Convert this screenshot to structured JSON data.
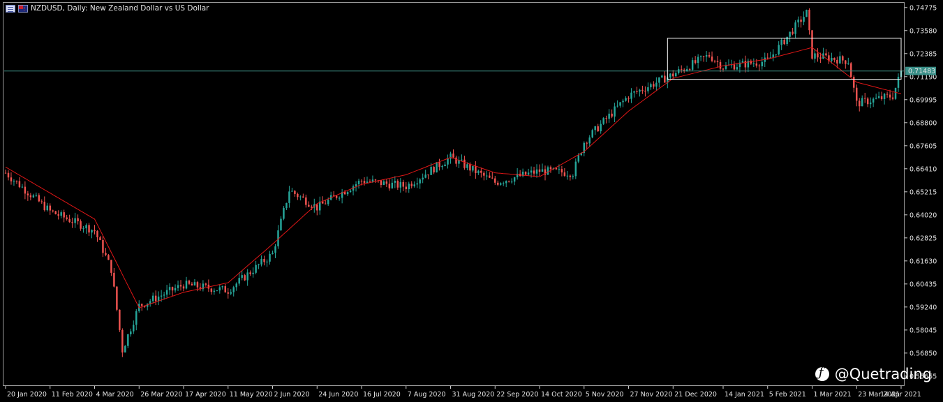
{
  "window": {
    "title": "NZDUSD, Daily:  New Zealand Dollar vs US Dollar",
    "icons": [
      "list-icon",
      "flag-icon"
    ]
  },
  "watermark": {
    "text": "@Quetrading",
    "icon": "logo-icon"
  },
  "colors": {
    "background": "#000000",
    "bull": "#26a69a",
    "bear": "#ef5350",
    "ma": "#e01616",
    "price_line": "#3e8f86",
    "price_tag": "#3a8f88",
    "box": "#ffffff",
    "grid_text": "#e6e6e6"
  },
  "chart_data": {
    "type": "candlestick",
    "symbol": "NZDUSD",
    "timeframe": "Daily",
    "title": "NZDUSD, Daily:  New Zealand Dollar vs US Dollar",
    "y_axis": {
      "ylim": [
        0.5518,
        0.7502
      ],
      "ticks": [
        "0.74775",
        "0.73580",
        "0.72385",
        "0.71190",
        "0.69995",
        "0.68800",
        "0.67605",
        "0.66410",
        "0.65215",
        "0.64020",
        "0.62825",
        "0.61630",
        "0.60435",
        "0.59240",
        "0.58045",
        "0.56850",
        "0.55655"
      ]
    },
    "x_axis": {
      "ticks": [
        "20 Jan 2020",
        "11 Feb 2020",
        "4 Mar 2020",
        "26 Mar 2020",
        "17 Apr 2020",
        "11 May 2020",
        "2 Jun 2020",
        "24 Jun 2020",
        "16 Jul 2020",
        "7 Aug 2020",
        "31 Aug 2020",
        "22 Sep 2020",
        "14 Oct 2020",
        "5 Nov 2020",
        "27 Nov 2020",
        "21 Dec 2020",
        "14 Jan 2021",
        "5 Feb 2021",
        "1 Mar 2021",
        "23 Mar 2021",
        "14 Apr 2021"
      ]
    },
    "current_price": "0.71483",
    "grid": false,
    "legend": "none",
    "price_path": [
      {
        "date": "20 Jan 2020",
        "price": 0.662
      },
      {
        "date": "11 Feb 2020",
        "price": 0.642
      },
      {
        "date": "4 Mar 2020",
        "price": 0.632
      },
      {
        "date": "12 Mar 2020",
        "price": 0.612
      },
      {
        "date": "18 Mar 2020",
        "price": 0.57
      },
      {
        "date": "26 Mar 2020",
        "price": 0.593
      },
      {
        "date": "17 Apr 2020",
        "price": 0.604
      },
      {
        "date": "11 May 2020",
        "price": 0.601
      },
      {
        "date": "2 Jun 2020",
        "price": 0.62
      },
      {
        "date": "10 Jun 2020",
        "price": 0.653
      },
      {
        "date": "24 Jun 2020",
        "price": 0.644
      },
      {
        "date": "16 Jul 2020",
        "price": 0.658
      },
      {
        "date": "7 Aug 2020",
        "price": 0.655
      },
      {
        "date": "31 Aug 2020",
        "price": 0.67
      },
      {
        "date": "22 Sep 2020",
        "price": 0.657
      },
      {
        "date": "14 Oct 2020",
        "price": 0.663
      },
      {
        "date": "30 Oct 2020",
        "price": 0.662
      },
      {
        "date": "5 Nov 2020",
        "price": 0.678
      },
      {
        "date": "27 Nov 2020",
        "price": 0.702
      },
      {
        "date": "21 Dec 2020",
        "price": 0.713
      },
      {
        "date": "7 Jan 2021",
        "price": 0.723
      },
      {
        "date": "14 Jan 2021",
        "price": 0.717
      },
      {
        "date": "5 Feb 2021",
        "price": 0.72
      },
      {
        "date": "25 Feb 2021",
        "price": 0.745
      },
      {
        "date": "1 Mar 2021",
        "price": 0.723
      },
      {
        "date": "18 Mar 2021",
        "price": 0.72
      },
      {
        "date": "23 Mar 2021",
        "price": 0.698
      },
      {
        "date": "9 Apr 2021",
        "price": 0.702
      },
      {
        "date": "14 Apr 2021",
        "price": 0.7145
      }
    ],
    "moving_average": [
      {
        "date": "20 Jan 2020",
        "price": 0.665
      },
      {
        "date": "4 Mar 2020",
        "price": 0.638
      },
      {
        "date": "26 Mar 2020",
        "price": 0.592
      },
      {
        "date": "17 Apr 2020",
        "price": 0.6
      },
      {
        "date": "11 May 2020",
        "price": 0.605
      },
      {
        "date": "2 Jun 2020",
        "price": 0.625
      },
      {
        "date": "24 Jun 2020",
        "price": 0.646
      },
      {
        "date": "16 Jul 2020",
        "price": 0.656
      },
      {
        "date": "7 Aug 2020",
        "price": 0.661
      },
      {
        "date": "31 Aug 2020",
        "price": 0.67
      },
      {
        "date": "22 Sep 2020",
        "price": 0.662
      },
      {
        "date": "14 Oct 2020",
        "price": 0.66
      },
      {
        "date": "5 Nov 2020",
        "price": 0.673
      },
      {
        "date": "27 Nov 2020",
        "price": 0.694
      },
      {
        "date": "21 Dec 2020",
        "price": 0.711
      },
      {
        "date": "14 Jan 2021",
        "price": 0.7175
      },
      {
        "date": "5 Feb 2021",
        "price": 0.721
      },
      {
        "date": "1 Mar 2021",
        "price": 0.727
      },
      {
        "date": "23 Mar 2021",
        "price": 0.709
      },
      {
        "date": "14 Apr 2021",
        "price": 0.703
      }
    ],
    "range_box": {
      "from": "17 Dec 2020",
      "to": "14 Apr 2021",
      "high": 0.7318,
      "low": 0.7105
    }
  }
}
